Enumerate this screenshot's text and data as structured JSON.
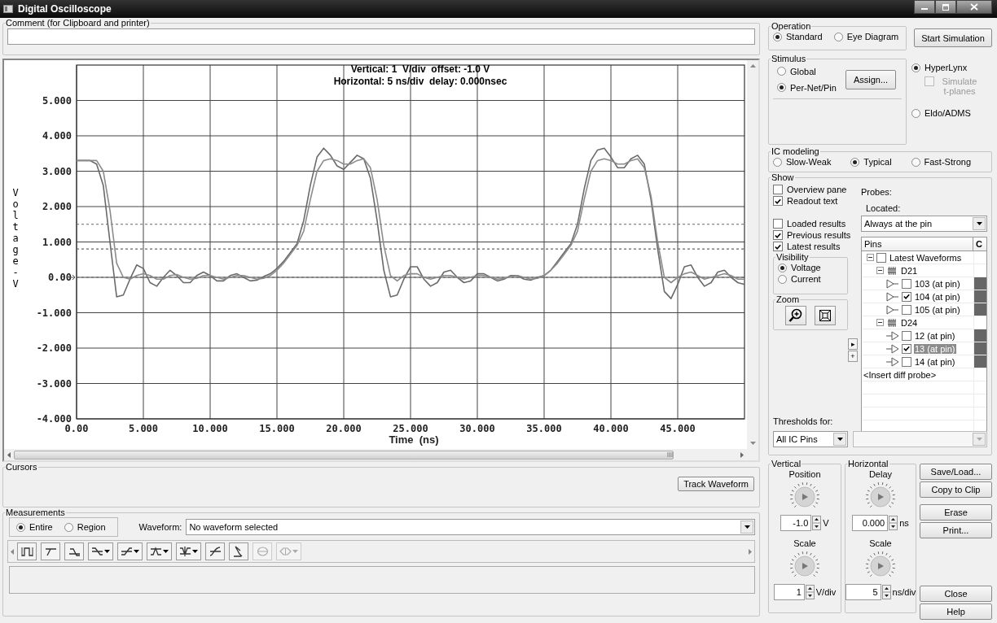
{
  "window": {
    "title": "Digital Oscilloscope"
  },
  "comment": {
    "label": "Comment (for Clipboard and printer)"
  },
  "plot": {
    "readout": [
      "Vertical: 1  V/div  offset: -1.0 V",
      "Horizontal: 5 ns/div  delay: 0.000nsec"
    ],
    "chart_data": {
      "type": "line",
      "xlabel": "Time  (ns)",
      "ylabel": "Voltage-V",
      "xlim": [
        0,
        50
      ],
      "ylim": [
        -4,
        6
      ],
      "xticks": [
        {
          "value": 0,
          "label": "0.00"
        },
        {
          "value": 5,
          "label": "5.000"
        },
        {
          "value": 10,
          "label": "10.000"
        },
        {
          "value": 15,
          "label": "15.000"
        },
        {
          "value": 20,
          "label": "20.000"
        },
        {
          "value": 25,
          "label": "25.000"
        },
        {
          "value": 30,
          "label": "30.000"
        },
        {
          "value": 35,
          "label": "35.000"
        },
        {
          "value": 40,
          "label": "40.000"
        },
        {
          "value": 45,
          "label": "45.000"
        }
      ],
      "yticks": [
        {
          "value": 5,
          "label": "5.000"
        },
        {
          "value": 4,
          "label": "4.000"
        },
        {
          "value": 3,
          "label": "3.000"
        },
        {
          "value": 2,
          "label": "2.000"
        },
        {
          "value": 1,
          "label": "1.000"
        },
        {
          "value": 0,
          "label": "0.00"
        },
        {
          "value": -1,
          "label": "-1.000"
        },
        {
          "value": -2,
          "label": "-2.000"
        },
        {
          "value": -3,
          "label": "-3.000"
        },
        {
          "value": -4,
          "label": "-4.000"
        }
      ],
      "grid": true,
      "x": [
        0,
        0.5,
        1,
        1.5,
        2,
        2.5,
        3,
        3.5,
        4,
        4.5,
        5,
        5.5,
        6,
        6.5,
        7,
        7.5,
        8,
        8.5,
        9,
        9.5,
        10,
        10.5,
        11,
        11.5,
        12,
        12.5,
        13,
        13.5,
        14,
        14.5,
        15,
        15.5,
        16,
        16.5,
        17,
        17.5,
        18,
        18.5,
        19,
        19.5,
        20,
        20.5,
        21,
        21.5,
        22,
        22.5,
        23,
        23.5,
        24,
        24.5,
        25,
        25.5,
        26,
        26.5,
        27,
        27.5,
        28,
        28.5,
        29,
        29.5,
        30,
        30.5,
        31,
        31.5,
        32,
        32.5,
        33,
        33.5,
        34,
        34.5,
        35,
        35.5,
        36,
        36.5,
        37,
        37.5,
        38,
        38.5,
        39,
        39.5,
        40,
        40.5,
        41,
        41.5,
        42,
        42.5,
        43,
        43.5,
        44,
        44.5,
        45,
        45.5,
        46,
        46.5,
        47,
        47.5,
        48,
        48.5,
        49,
        49.5,
        50
      ],
      "series": [
        {
          "color": "#6a6a6a",
          "values": [
            3.3,
            3.3,
            3.3,
            3.2,
            2.6,
            1.0,
            -0.55,
            -0.5,
            -0.05,
            0.35,
            0.25,
            -0.15,
            -0.25,
            0.0,
            0.2,
            0.05,
            -0.15,
            -0.15,
            0.05,
            0.15,
            0.05,
            -0.1,
            -0.1,
            0.05,
            0.1,
            0.0,
            -0.1,
            -0.08,
            0.02,
            0.1,
            0.25,
            0.45,
            0.7,
            0.95,
            1.6,
            2.6,
            3.4,
            3.65,
            3.45,
            3.15,
            3.05,
            3.25,
            3.45,
            3.35,
            2.8,
            1.6,
            0.2,
            -0.55,
            -0.5,
            -0.05,
            0.3,
            0.3,
            -0.05,
            -0.25,
            -0.15,
            0.15,
            0.2,
            0.0,
            -0.15,
            -0.1,
            0.1,
            0.1,
            0.0,
            -0.1,
            -0.05,
            0.05,
            0.05,
            -0.05,
            -0.08,
            0.0,
            0.05,
            0.2,
            0.45,
            0.7,
            0.95,
            1.5,
            2.5,
            3.3,
            3.6,
            3.65,
            3.4,
            3.1,
            3.1,
            3.35,
            3.45,
            3.2,
            2.2,
            0.8,
            -0.4,
            -0.6,
            -0.2,
            0.3,
            0.35,
            0.0,
            -0.25,
            -0.15,
            0.15,
            0.2,
            0.0,
            -0.15,
            -0.2
          ]
        },
        {
          "color": "#8c8c8c",
          "values": [
            3.3,
            3.3,
            3.3,
            3.3,
            3.0,
            1.9,
            0.4,
            0.0,
            -0.05,
            0.05,
            0.1,
            0.05,
            -0.05,
            -0.05,
            0.05,
            0.08,
            0.0,
            -0.05,
            -0.03,
            0.05,
            0.05,
            0.0,
            -0.05,
            0.0,
            0.05,
            0.05,
            0.0,
            -0.05,
            -0.03,
            0.05,
            0.2,
            0.4,
            0.65,
            0.9,
            1.3,
            2.2,
            3.0,
            3.3,
            3.35,
            3.3,
            3.2,
            3.2,
            3.3,
            3.35,
            3.1,
            2.2,
            0.9,
            0.05,
            -0.1,
            0.05,
            0.1,
            0.1,
            0.0,
            -0.05,
            0.0,
            0.05,
            0.05,
            0.0,
            -0.05,
            0.0,
            0.05,
            0.05,
            0.0,
            -0.05,
            -0.03,
            0.03,
            0.05,
            0.0,
            -0.05,
            -0.03,
            0.05,
            0.2,
            0.4,
            0.65,
            0.9,
            1.3,
            2.2,
            3.0,
            3.3,
            3.35,
            3.3,
            3.2,
            3.2,
            3.3,
            3.35,
            3.1,
            2.3,
            1.0,
            0.0,
            -0.15,
            0.0,
            0.1,
            0.15,
            0.05,
            -0.05,
            0.0,
            0.05,
            0.1,
            0.05,
            -0.05,
            -0.05
          ]
        }
      ]
    }
  },
  "cursors": {
    "label": "Cursors",
    "button": "Track Waveform"
  },
  "measurements": {
    "label": "Measurements",
    "scope": [
      {
        "label": "Entire",
        "selected": true
      },
      {
        "label": "Region",
        "selected": false
      }
    ],
    "waveform_label": "Waveform:",
    "waveform_value": "No waveform selected",
    "tools": [
      {
        "kind": "pulse",
        "dropdown": false,
        "disabled": false
      },
      {
        "kind": "rise",
        "dropdown": false,
        "disabled": false
      },
      {
        "kind": "fall",
        "dropdown": false,
        "disabled": false
      },
      {
        "kind": "fall-skew",
        "dropdown": true,
        "disabled": false
      },
      {
        "kind": "rise-skew",
        "dropdown": true,
        "disabled": false
      },
      {
        "kind": "overshoot",
        "dropdown": true,
        "disabled": false
      },
      {
        "kind": "undershoot",
        "dropdown": true,
        "disabled": false
      },
      {
        "kind": "curve",
        "dropdown": false,
        "disabled": false
      },
      {
        "kind": "probe",
        "dropdown": false,
        "disabled": false
      },
      {
        "kind": "ellipse",
        "dropdown": false,
        "disabled": true
      },
      {
        "kind": "diamond",
        "dropdown": true,
        "disabled": true
      }
    ]
  },
  "operation": {
    "label": "Operation",
    "options": [
      {
        "label": "Standard",
        "selected": true
      },
      {
        "label": "Eye Diagram",
        "selected": false
      }
    ]
  },
  "start_button": "Start Simulation",
  "stimulus": {
    "label": "Stimulus",
    "options": [
      {
        "label": "Global",
        "selected": false
      },
      {
        "label": "Per-Net/Pin",
        "selected": true
      }
    ],
    "assign_button": "Assign..."
  },
  "simulator": {
    "options": [
      {
        "label": "HyperLynx",
        "selected": true
      },
      {
        "label": "Eldo/ADMS",
        "selected": false
      }
    ],
    "t_planes": {
      "label": "Simulate t-planes",
      "checked": false,
      "disabled": true
    }
  },
  "ic_modeling": {
    "label": "IC modeling",
    "options": [
      {
        "label": "Slow-Weak",
        "selected": false
      },
      {
        "label": "Typical",
        "selected": true
      },
      {
        "label": "Fast-Strong",
        "selected": false
      }
    ]
  },
  "show": {
    "label": "Show",
    "options": [
      {
        "label": "Overview pane",
        "checked": false
      },
      {
        "label": "Readout text",
        "checked": true
      },
      {
        "label": "Loaded results",
        "checked": false
      },
      {
        "label": "Previous results",
        "checked": true
      },
      {
        "label": "Latest results",
        "checked": true
      }
    ],
    "visibility": {
      "label": "Visibility",
      "options": [
        {
          "label": "Voltage",
          "selected": true
        },
        {
          "label": "Current",
          "selected": false
        }
      ]
    },
    "zoom": {
      "label": "Zoom"
    },
    "side_buttons": [
      "▸",
      "+"
    ],
    "probes_label": "Probes:",
    "located_label": "Located:",
    "located_value": "Always at the pin",
    "columns": [
      "Pins",
      "C"
    ],
    "tree": [
      {
        "kind": "group",
        "label": "Latest Waveforms",
        "checked": false,
        "expanded": true,
        "children": [
          {
            "kind": "component",
            "label": "D21",
            "expanded": true,
            "children": [
              {
                "kind": "driver",
                "label": "103 (at pin)",
                "checked": false,
                "selected": false
              },
              {
                "kind": "driver",
                "label": "104 (at pin)",
                "checked": true,
                "selected": false
              },
              {
                "kind": "driver",
                "label": "105 (at pin)",
                "checked": false,
                "selected": false
              }
            ]
          },
          {
            "kind": "component",
            "label": "D24",
            "expanded": true,
            "children": [
              {
                "kind": "receiver",
                "label": "12 (at pin)",
                "checked": false,
                "selected": false
              },
              {
                "kind": "receiver",
                "label": "13 (at pin)",
                "checked": true,
                "selected": true
              },
              {
                "kind": "receiver",
                "label": "14 (at pin)",
                "checked": false,
                "selected": false
              }
            ]
          }
        ]
      }
    ],
    "insert_row": "<Insert diff probe>",
    "thresholds_label": "Thresholds for:",
    "thresholds_value": "All IC Pins"
  },
  "vertical": {
    "label": "Vertical",
    "knobs": [
      {
        "title": "Position",
        "value": "-1.0",
        "unit": "V"
      },
      {
        "title": "Scale",
        "value": "1",
        "unit": "V/div"
      }
    ]
  },
  "horizontal": {
    "label": "Horizontal",
    "knobs": [
      {
        "title": "Delay",
        "value": "0.000",
        "unit": "ns"
      },
      {
        "title": "Scale",
        "value": "5",
        "unit": "ns/div"
      }
    ]
  },
  "side_buttons": [
    [
      "Save/Load...",
      "Copy to Clip"
    ],
    [
      "Erase",
      "Print..."
    ],
    [
      "Close",
      "Help"
    ]
  ]
}
